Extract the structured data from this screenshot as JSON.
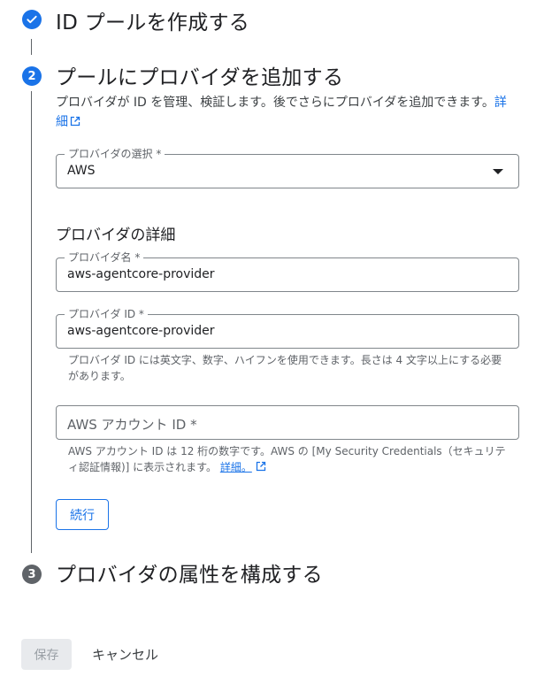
{
  "steps": {
    "step1": {
      "title": "ID プールを作成する"
    },
    "step2": {
      "number": "2",
      "title": "プールにプロバイダを追加する"
    },
    "step3": {
      "number": "3",
      "title": "プロバイダの属性を構成する"
    }
  },
  "description": {
    "text": "プロバイダが ID を管理、検証します。後でさらにプロバイダを追加できます。",
    "link": "詳細"
  },
  "provider_select": {
    "label": "プロバイダの選択 *",
    "value": "AWS"
  },
  "provider_details_title": "プロバイダの詳細",
  "provider_name": {
    "label": "プロバイダ名 *",
    "value": "aws-agentcore-provider"
  },
  "provider_id": {
    "label": "プロバイダ ID *",
    "value": "aws-agentcore-provider",
    "hint": "プロバイダ ID には英文字、数字、ハイフンを使用できます。長さは 4 文字以上にする必要があります。"
  },
  "aws_account": {
    "placeholder": "AWS アカウント ID *",
    "hint": "AWS アカウント ID は 12 桁の数字です。AWS の [My Security Credentials（セキュリティ認証情報)] に表示されます。",
    "link": "詳細。"
  },
  "buttons": {
    "continue": "続行",
    "save": "保存",
    "cancel": "キャンセル"
  },
  "colors": {
    "accent": "#1a73e8",
    "pending_step": "#5f6368"
  }
}
